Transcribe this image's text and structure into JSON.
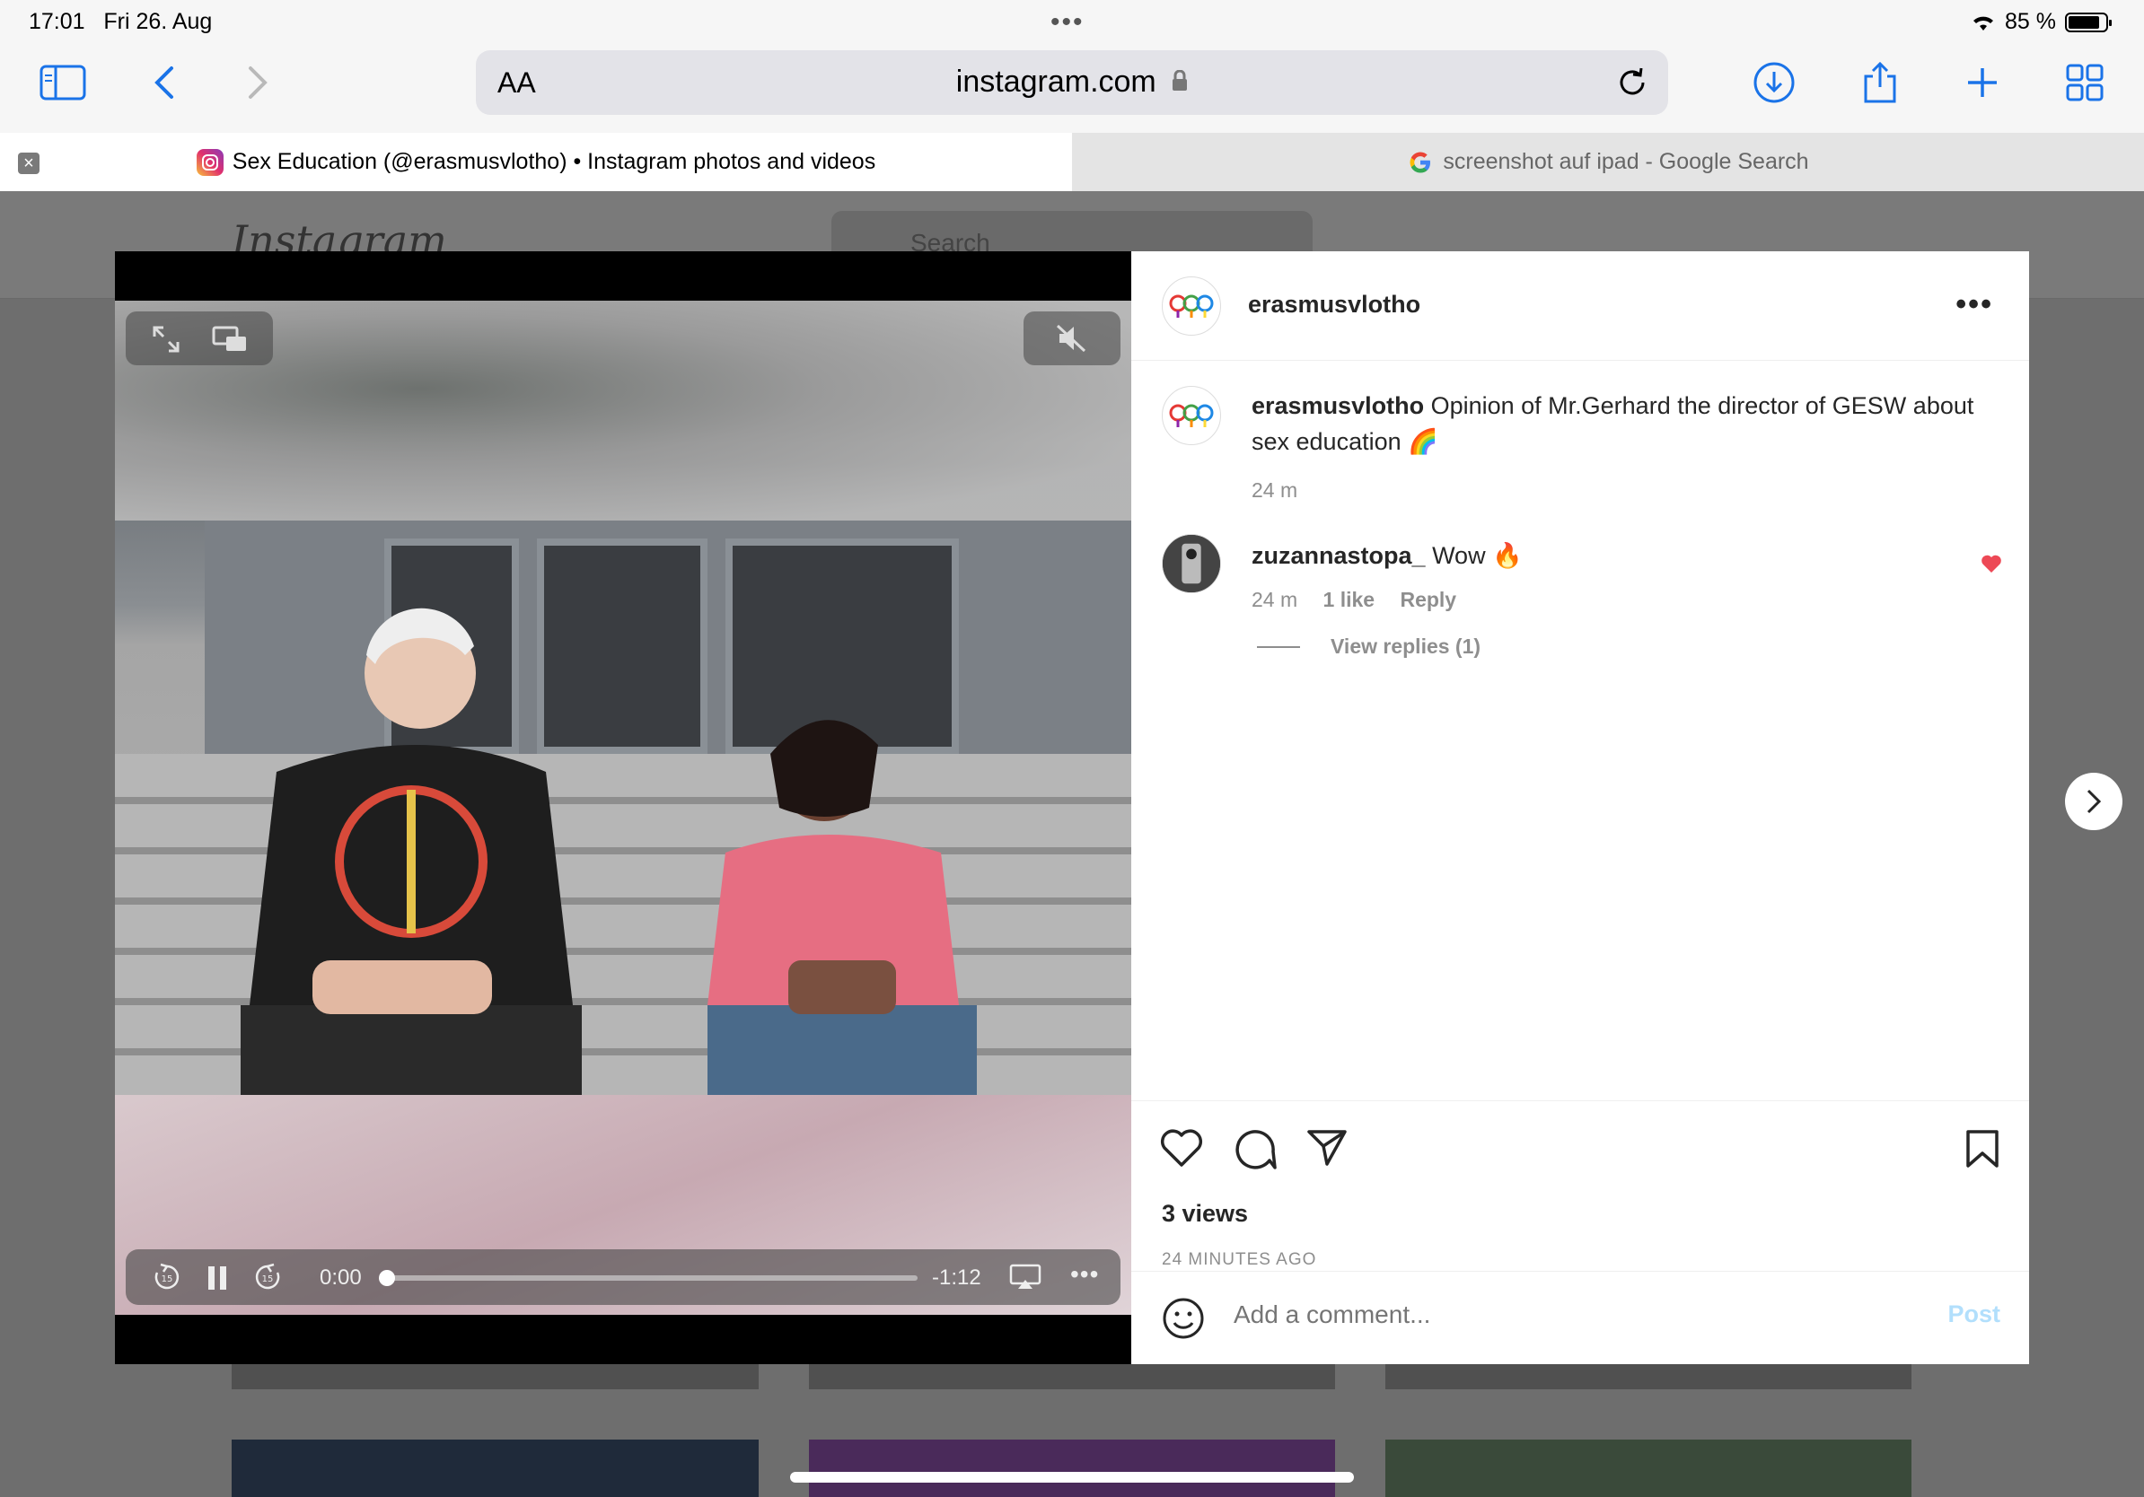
{
  "status_bar": {
    "time": "17:01",
    "date": "Fri 26. Aug",
    "battery": "85 %",
    "battery_level": 0.85
  },
  "browser": {
    "url_aa": "AA",
    "url": "instagram.com",
    "tabs": [
      {
        "title": "Sex Education (@erasmusvlotho) • Instagram photos and videos",
        "active": true
      },
      {
        "title": "screenshot auf ipad - Google Search",
        "active": false
      }
    ]
  },
  "instagram_page": {
    "logo": "Instagram",
    "search_placeholder": "Search"
  },
  "video": {
    "current_time": "0:00",
    "remaining_time": "-1:12",
    "skip_seconds": "15",
    "progress": 0.0
  },
  "post": {
    "author": "erasmusvlotho",
    "caption_user": "erasmusvlotho",
    "caption_text": "Opinion of Mr.Gerhard the director of GESW about sex education 🌈",
    "caption_time": "24 m",
    "comments": [
      {
        "user": "zuzannastopa_",
        "text": "Wow 🔥",
        "time": "24 m",
        "likes": "1 like",
        "reply_label": "Reply",
        "liked": true,
        "view_replies": "View replies (1)"
      }
    ],
    "views": "3 views",
    "posted_ago": "24 MINUTES AGO",
    "comment_placeholder": "Add a comment...",
    "post_label": "Post"
  },
  "colors": {
    "accent_blue": "#1a73e8",
    "like_red": "#ed4956",
    "post_disabled": "#b2dffc"
  }
}
